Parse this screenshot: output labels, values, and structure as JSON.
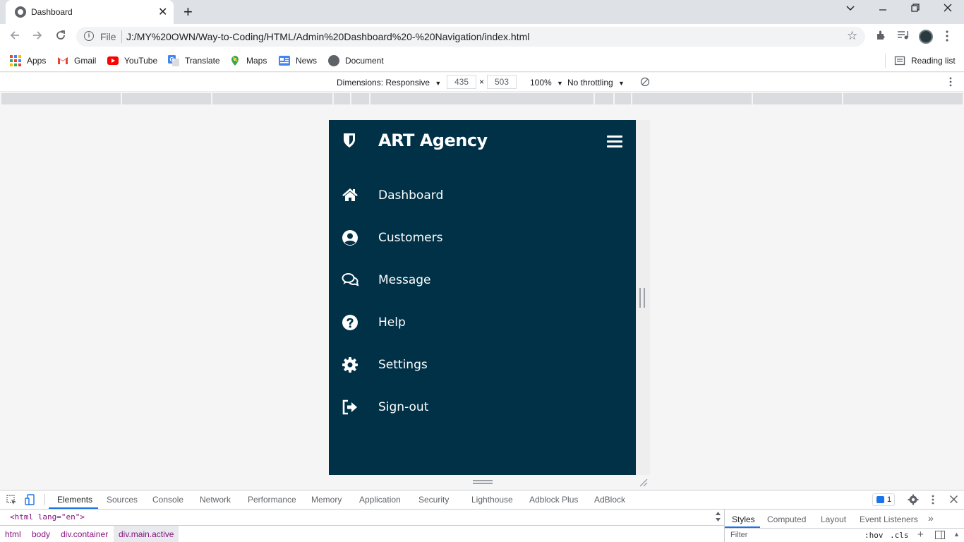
{
  "browser": {
    "tab_title": "Dashboard",
    "omnibox": {
      "scheme": "File",
      "url": "J:/MY%20OWN/Way-to-Coding/HTML/Admin%20Dashboard%20-%20Navigation/index.html"
    }
  },
  "bookmarks": {
    "items": [
      {
        "label": "Apps",
        "icon": "apps-grid-icon"
      },
      {
        "label": "Gmail",
        "icon": "gmail-icon"
      },
      {
        "label": "YouTube",
        "icon": "youtube-icon"
      },
      {
        "label": "Translate",
        "icon": "translate-icon"
      },
      {
        "label": "Maps",
        "icon": "maps-icon"
      },
      {
        "label": "News",
        "icon": "news-icon"
      },
      {
        "label": "Document",
        "icon": "globe-icon"
      }
    ],
    "reading_list": "Reading list"
  },
  "device_toolbar": {
    "dimensions": "Dimensions: Responsive",
    "width": "435",
    "height": "503",
    "zoom": "100%",
    "throttling": "No throttling"
  },
  "app": {
    "brand": "ART Agency",
    "nav": [
      {
        "label": "Dashboard",
        "icon": "home-icon"
      },
      {
        "label": "Customers",
        "icon": "user-circle-icon"
      },
      {
        "label": "Message",
        "icon": "chat-icon"
      },
      {
        "label": "Help",
        "icon": "help-icon"
      },
      {
        "label": "Settings",
        "icon": "gear-icon"
      },
      {
        "label": "Sign-out",
        "icon": "sign-out-icon"
      }
    ],
    "colors": {
      "sidebar": "#003147",
      "text": "#ffffff"
    }
  },
  "devtools": {
    "tabs": [
      "Elements",
      "Sources",
      "Console",
      "Network",
      "Performance",
      "Memory",
      "Application",
      "Security",
      "Lighthouse",
      "Adblock Plus",
      "AdBlock"
    ],
    "active_tab": "Elements",
    "issues_count": "1",
    "html_line": "<html lang=\"en\">",
    "breadcrumbs": [
      "html",
      "body",
      "div.container",
      "div.main.active"
    ],
    "styles_tabs": [
      "Styles",
      "Computed",
      "Layout",
      "Event Listeners"
    ],
    "filter_placeholder": "Filter",
    "hov": ":hov",
    "cls": ".cls"
  }
}
